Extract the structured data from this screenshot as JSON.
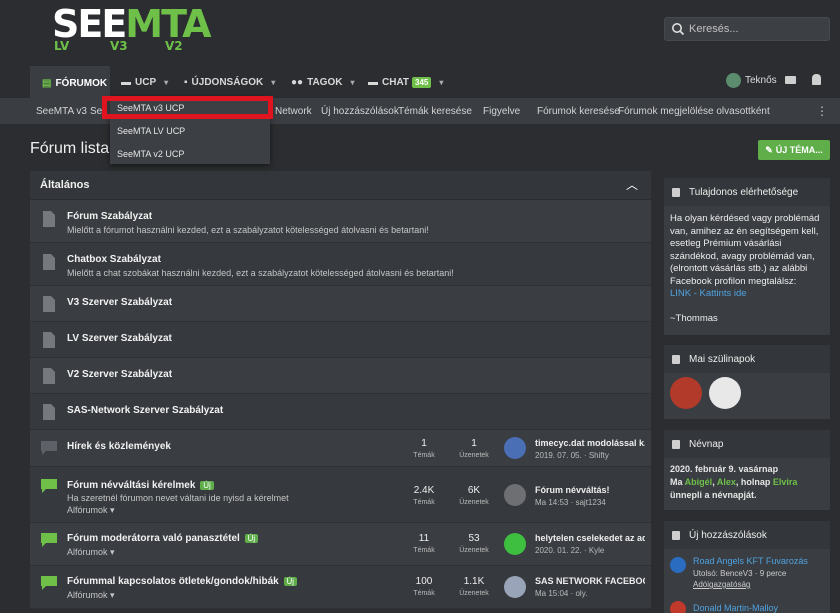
{
  "header": {
    "logo": {
      "main_white": "SEE",
      "main_green": "MTA",
      "v_lv": "LV",
      "v_v3": "V3",
      "v_v2": "V2"
    },
    "search_placeholder": "Keresés..."
  },
  "nav": {
    "items": [
      {
        "label": "FÓRUMOK"
      },
      {
        "label": "UCP"
      },
      {
        "label": "ÚJDONSÁGOK"
      },
      {
        "label": "TAGOK"
      },
      {
        "label": "CHAT",
        "badge": "345"
      }
    ],
    "user": "Teknős"
  },
  "subnav": {
    "items": [
      "SeeMTA v3",
      "Se",
      "Network",
      "Új hozzászólások",
      "Témák keresése",
      "Figyelve",
      "Fórumok keresése",
      "Fórumok megjelölése olvasottként"
    ]
  },
  "dropdown": {
    "items": [
      "SeeMTA v3 UCP",
      "SeeMTA LV UCP",
      "SeeMTA v2 UCP"
    ]
  },
  "page": {
    "title": "Fórum lista",
    "new_topic": "ÚJ TÉMA..."
  },
  "block": {
    "title": "Általános",
    "rows": [
      {
        "title": "Fórum Szabályzat",
        "desc": "Mielőtt a fórumot használni kezded, ezt a szabályzatot kötelességed átolvasni és betartani!"
      },
      {
        "title": "Chatbox Szabályzat",
        "desc": "Mielőtt a chat szobákat használni kezded, ezt a szabályzatot kötelességed átolvasni és betartani!"
      },
      {
        "title": "V3 Szerver Szabályzat"
      },
      {
        "title": "LV Szerver Szabályzat"
      },
      {
        "title": "V2 Szerver Szabályzat"
      },
      {
        "title": "SAS-Network Szerver Szabályzat"
      },
      {
        "title": "Hírek és közlemények",
        "threads": "1",
        "threads_label": "Témák",
        "messages": "1",
        "messages_label": "Üzenetek",
        "last_title": "timecyc.dat modolással k...",
        "last_meta": "2019. 07. 05. · Shifty"
      },
      {
        "title": "Fórum névváltási kérelmek",
        "uj": "Új",
        "desc": "Ha szeretnél fórumon nevet váltani ide nyisd a kérelmet",
        "sub": "Alfórumok",
        "threads": "2.4K",
        "threads_label": "Témák",
        "messages": "6K",
        "messages_label": "Üzenetek",
        "last_title": "Fórum névváltás!",
        "last_meta": "Ma 14:53 · sajt1234"
      },
      {
        "title": "Fórum moderátorra való panasztétel",
        "uj": "Új",
        "sub": "Alfórumok",
        "threads": "11",
        "threads_label": "Témák",
        "messages": "53",
        "messages_label": "Üzenetek",
        "last_title": "helytelen cselekedet az ad...",
        "last_meta": "2020. 01. 22. · Kyle"
      },
      {
        "title": "Fórummal kapcsolatos ötletek/gondok/hibák",
        "uj": "Új",
        "sub": "Alfórumok",
        "threads": "100",
        "threads_label": "Témák",
        "messages": "1.1K",
        "messages_label": "Üzenetek",
        "last_title": "SAS NETWORK FACEBOOK",
        "last_meta": "Ma 15:04 · oly."
      }
    ]
  },
  "sidebar": {
    "owner": {
      "title": "Tulajdonos elérhetősége",
      "text": "Ha olyan kérdésed vagy problémád van, amihez az én segítségem kell, esetleg Prémium vásárlási szándékod, avagy problémád van, (elrontott vásárlás stb.) az alábbi Facebook profilon megtalálsz:",
      "link": "LINK - Kattints ide",
      "sign": "~Thommas"
    },
    "birthdays": {
      "title": "Mai szülinapok"
    },
    "nameday": {
      "title": "Névnap",
      "date": "2020. február 9. vasárnap",
      "l2_a": "Ma ",
      "l2_b": "Abigél",
      "l2_c": ", ",
      "l2_d": "Alex",
      "l2_e": ", holnap ",
      "l2_f": "Elvira",
      "l3": "ünnepli a névnapját."
    },
    "new_posts": {
      "title": "Új hozzászólások",
      "items": [
        {
          "title": "Road Angels KFT Fuvarozás",
          "meta": "Utolsó: BenceV3 · 9 perce",
          "forum": "Adóigazgatóság"
        },
        {
          "title": "Donald Martin-Malloy"
        }
      ]
    }
  },
  "colors": {
    "accent": "#6ec049",
    "link": "#4fa3e0",
    "highlight": "#e0141e"
  }
}
